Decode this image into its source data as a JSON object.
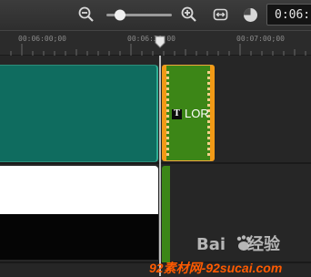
{
  "toolbar": {
    "timecode": "0:06:",
    "zoom_level": 0.15,
    "icons": [
      "zoom-out-icon",
      "zoom-in-icon",
      "fit-to-window-icon",
      "clock-icon"
    ]
  },
  "ruler": {
    "ticks": [
      "00:06:00;00",
      "00:06:30;00",
      "00:07:00;00"
    ]
  },
  "timeline": {
    "title_clip": {
      "label": "LORI",
      "icon_glyph": "T"
    },
    "colors": {
      "teal_clip": "#0f6c5f",
      "title_clip": "#3c8617",
      "title_clip_border": "#f29a16",
      "white_clip": "#ffffff",
      "black_clip": "#050505",
      "playhead": "#bfbfbf"
    }
  },
  "watermark": {
    "brand_left": "Bai",
    "brand_right": "经验",
    "site": "92素材网-92sucai.com"
  }
}
